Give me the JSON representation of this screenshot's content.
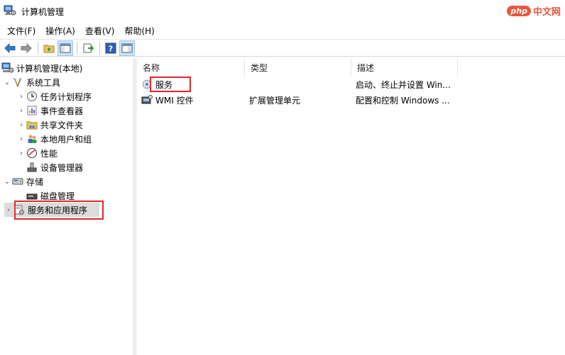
{
  "window": {
    "title": "计算机管理"
  },
  "watermark": {
    "php": "php",
    "cn": "中文网"
  },
  "menu": [
    "文件(F)",
    "操作(A)",
    "查看(V)",
    "帮助(H)"
  ],
  "toolbar": {
    "buttons": [
      "back-icon",
      "forward-icon",
      "up-folder-icon",
      "show-hide-tree-icon",
      "export-list-icon",
      "help-icon",
      "show-hide-action-pane-icon"
    ]
  },
  "tree": {
    "root": "计算机管理(本地)",
    "system_tools": "系统工具",
    "task_scheduler": "任务计划程序",
    "event_viewer": "事件查看器",
    "shared_folders": "共享文件夹",
    "local_users": "本地用户和组",
    "performance": "性能",
    "device_manager": "设备管理器",
    "storage": "存储",
    "disk_management": "磁盘管理",
    "services_apps": "服务和应用程序"
  },
  "list": {
    "columns": [
      "名称",
      "类型",
      "描述"
    ],
    "rows": [
      {
        "name": "服务",
        "type": "",
        "description": "启动、终止并设置 Win..."
      },
      {
        "name": "WMI 控件",
        "type": "扩展管理单元",
        "description": "配置和控制 Windows ..."
      }
    ]
  },
  "colors": {
    "highlight": "#e0262d",
    "selection": "#dcdcdc",
    "accent": "#e9563b"
  }
}
